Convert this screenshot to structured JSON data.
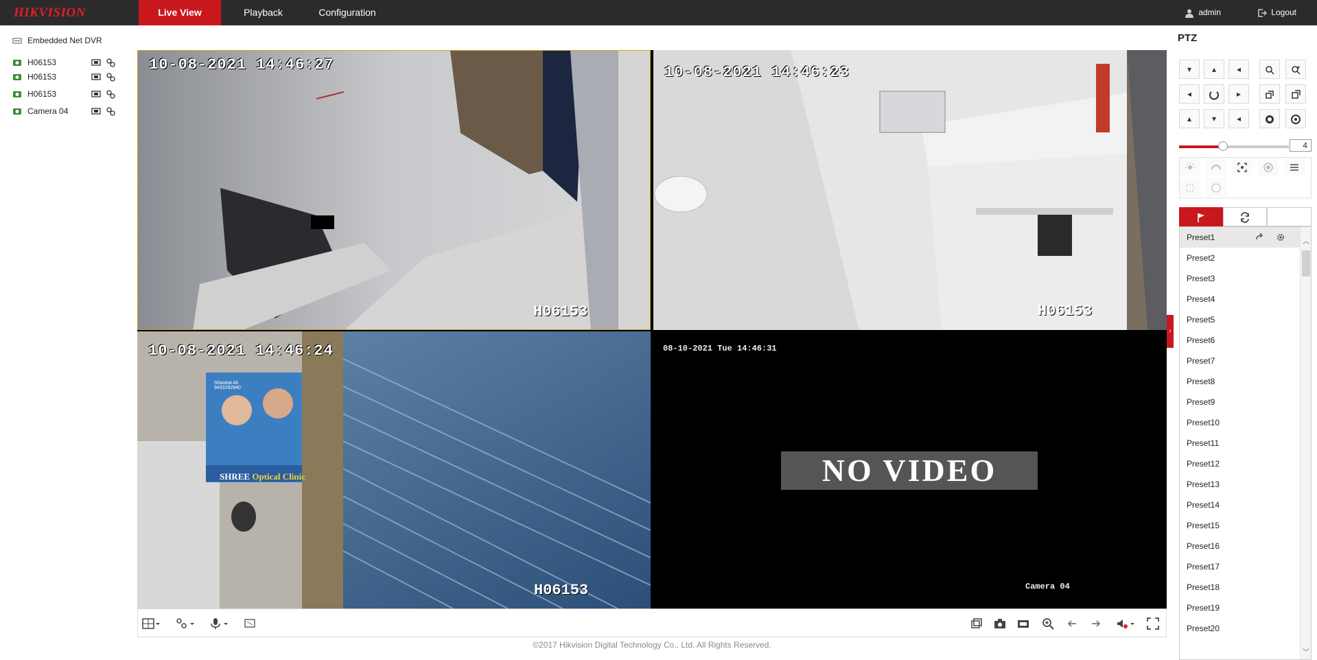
{
  "app": {
    "logo": "HIKVISION"
  },
  "nav": {
    "live_view": "Live View",
    "playback": "Playback",
    "configuration": "Configuration"
  },
  "user": {
    "name": "admin",
    "logout": "Logout"
  },
  "tree": {
    "root": "Embedded Net DVR",
    "cameras": [
      {
        "label": "H06153"
      },
      {
        "label": "H06153"
      },
      {
        "label": "H06153"
      },
      {
        "label": "Camera 04"
      }
    ]
  },
  "views": [
    {
      "timestamp": "10-08-2021 14:46:27",
      "name": "H06153"
    },
    {
      "timestamp": "10-08-2021 14:46:23",
      "name": "H06153"
    },
    {
      "timestamp": "10-08-2021 14:46:24",
      "name": "H06153"
    },
    {
      "timestamp": "08-10-2021 Tue 14:46:31",
      "name": "Camera 04",
      "status": "NO VIDEO"
    }
  ],
  "sign": {
    "line1": "Shaukat Ali",
    "line2": "9433292940",
    "brand": "SHREE",
    "brand2": "Optical Clinic"
  },
  "ptz": {
    "title": "PTZ",
    "speed": "4",
    "speed_level": 0.4
  },
  "presets": [
    "Preset1",
    "Preset2",
    "Preset3",
    "Preset4",
    "Preset5",
    "Preset6",
    "Preset7",
    "Preset8",
    "Preset9",
    "Preset10",
    "Preset11",
    "Preset12",
    "Preset13",
    "Preset14",
    "Preset15",
    "Preset16",
    "Preset17",
    "Preset18",
    "Preset19",
    "Preset20"
  ],
  "footer": "©2017 Hikvision Digital Technology Co., Ltd. All Rights Reserved.",
  "colors": {
    "accent": "#c8171d",
    "topbar": "#2b2b2b",
    "selected_border": "#d4a017"
  }
}
